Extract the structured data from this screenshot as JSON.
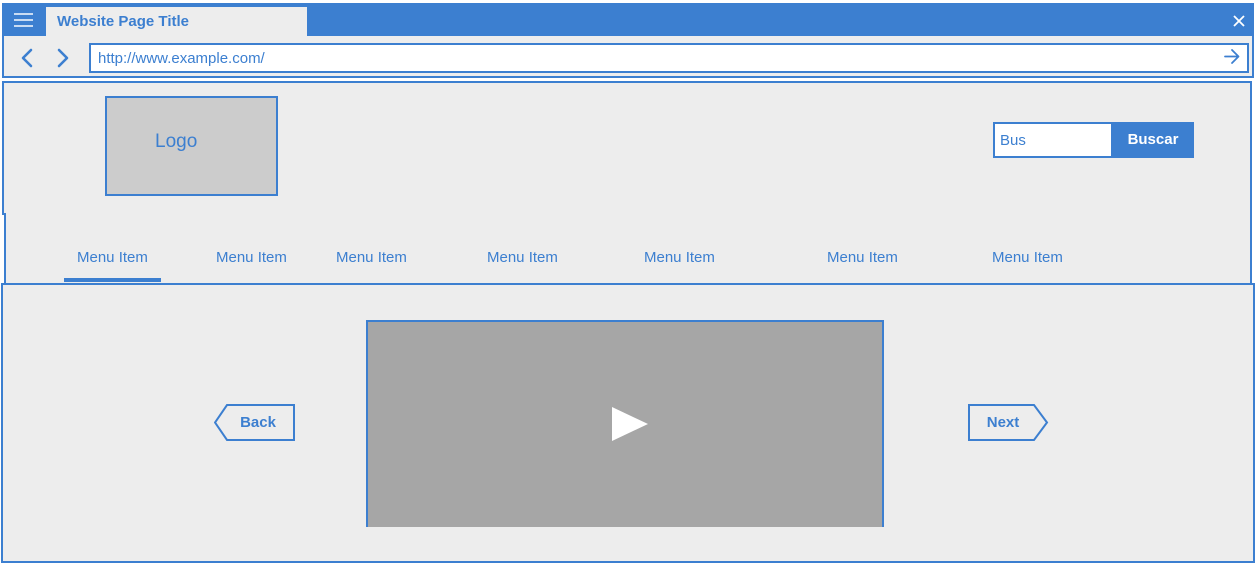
{
  "browser": {
    "tab_title": "Website Page Title",
    "url": "http://www.example.com/",
    "icons": [
      "hamburger-menu-icon",
      "close-icon",
      "back-arrow-icon",
      "forward-arrow-icon",
      "go-arrow-icon"
    ]
  },
  "header": {
    "logo_label": "Logo",
    "search_value": "Bus",
    "search_button": "Buscar"
  },
  "nav": {
    "items": [
      {
        "label": "Menu Item",
        "active": true
      },
      {
        "label": "Menu Item"
      },
      {
        "label": "Menu Item"
      },
      {
        "label": "Menu Item"
      },
      {
        "label": "Menu Item"
      },
      {
        "label": "Menu Item"
      },
      {
        "label": "Menu Item"
      }
    ]
  },
  "content": {
    "back_label": "Back",
    "next_label": "Next",
    "video_icon": "play-icon"
  },
  "colors": {
    "accent": "#3c7fd0",
    "background": "#ededed",
    "logo_fill": "#cccccc",
    "video_fill": "#a6a6a6"
  }
}
